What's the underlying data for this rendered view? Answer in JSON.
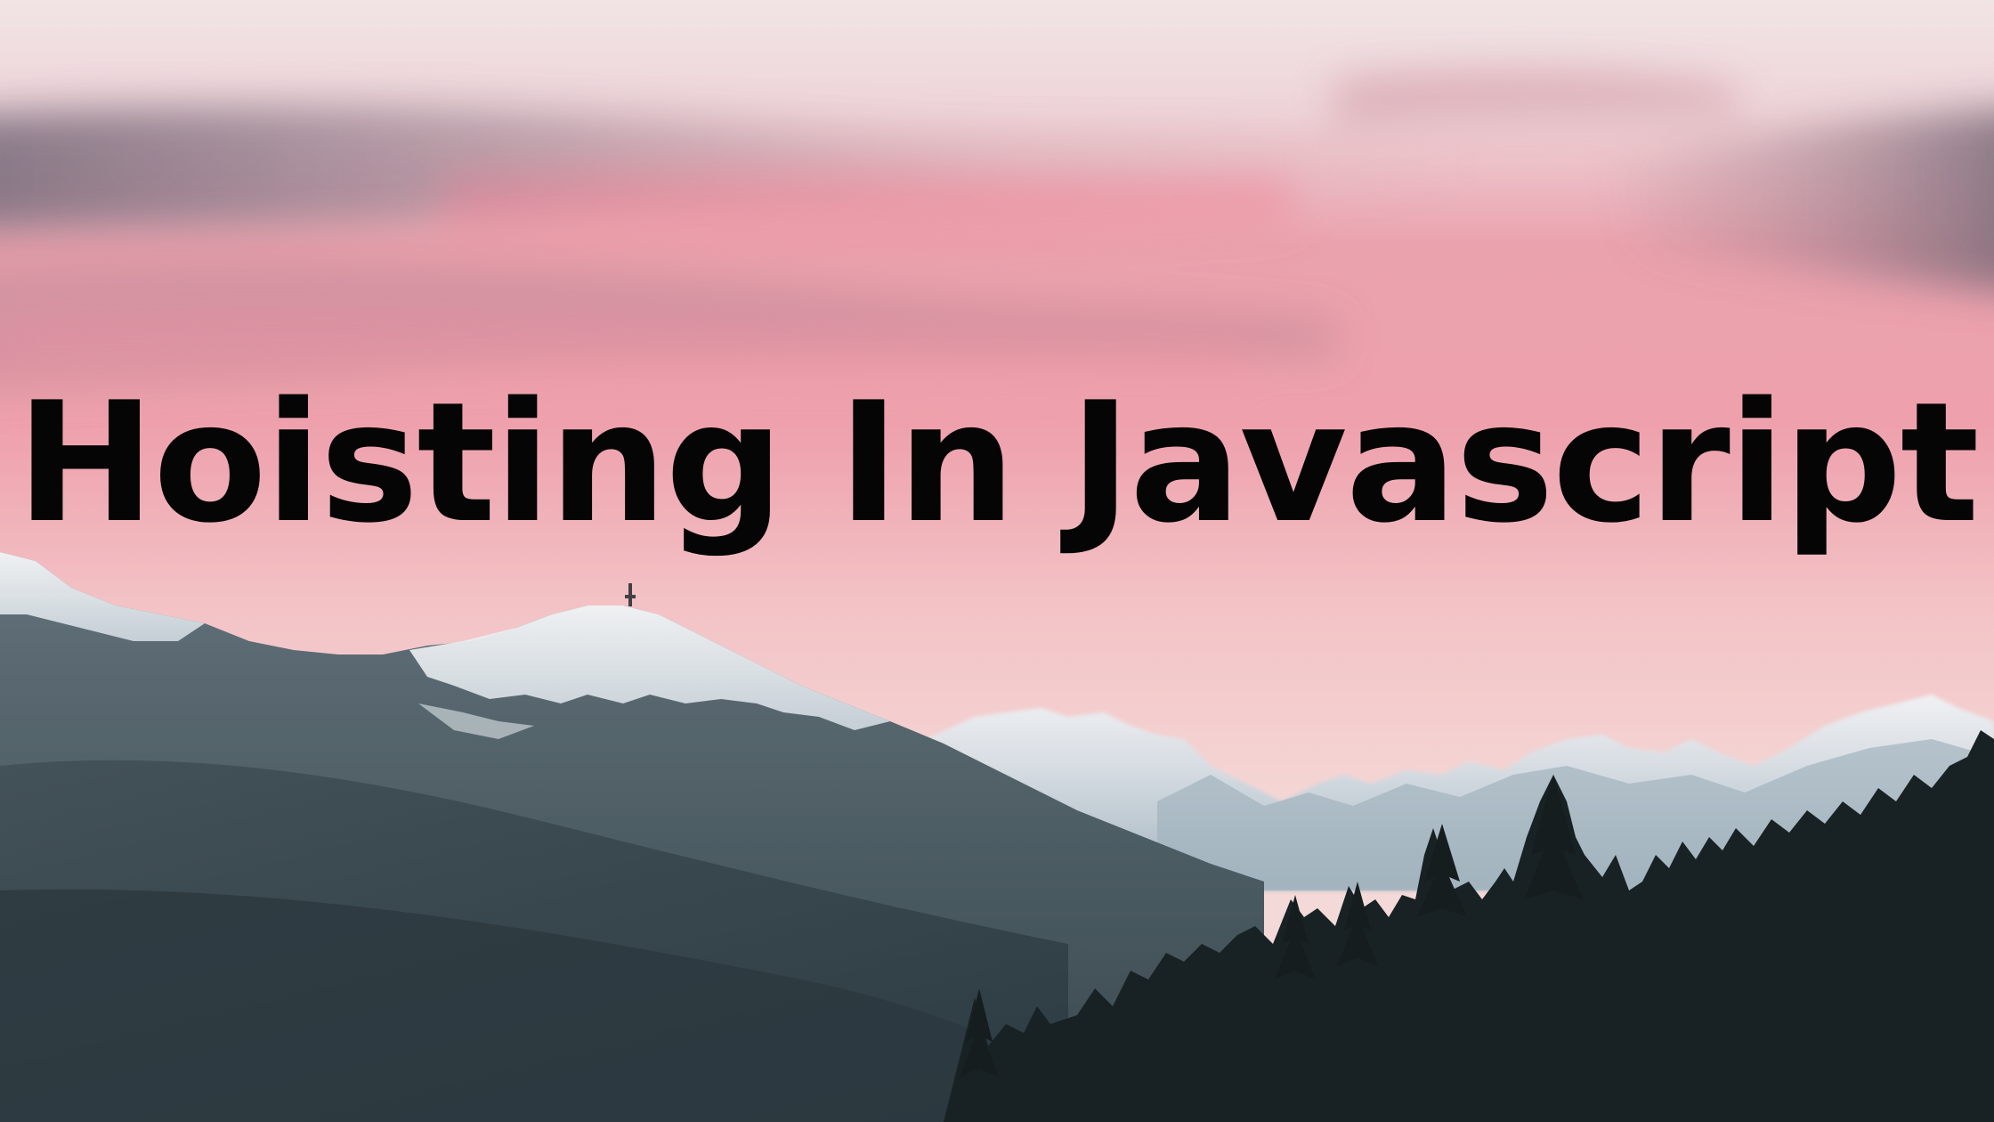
{
  "title": "Hoisting In Javascript",
  "scene": {
    "subject": "pink sunset sky over snow-capped mountains with a dark pine forest silhouette",
    "colors": {
      "sky_light": "#f1dfe2",
      "sky_pink": "#ee9aa7",
      "sky_haze": "#f3cfcf",
      "cloud_gray": "#7f7485",
      "mountain_snow": "#e8ecef",
      "mountain_far": "#a9b9c3",
      "mountain_mid": "#56656d",
      "mountain_near": "#2c3a40",
      "forest": "#121a1c",
      "title_text": "#050505"
    }
  }
}
